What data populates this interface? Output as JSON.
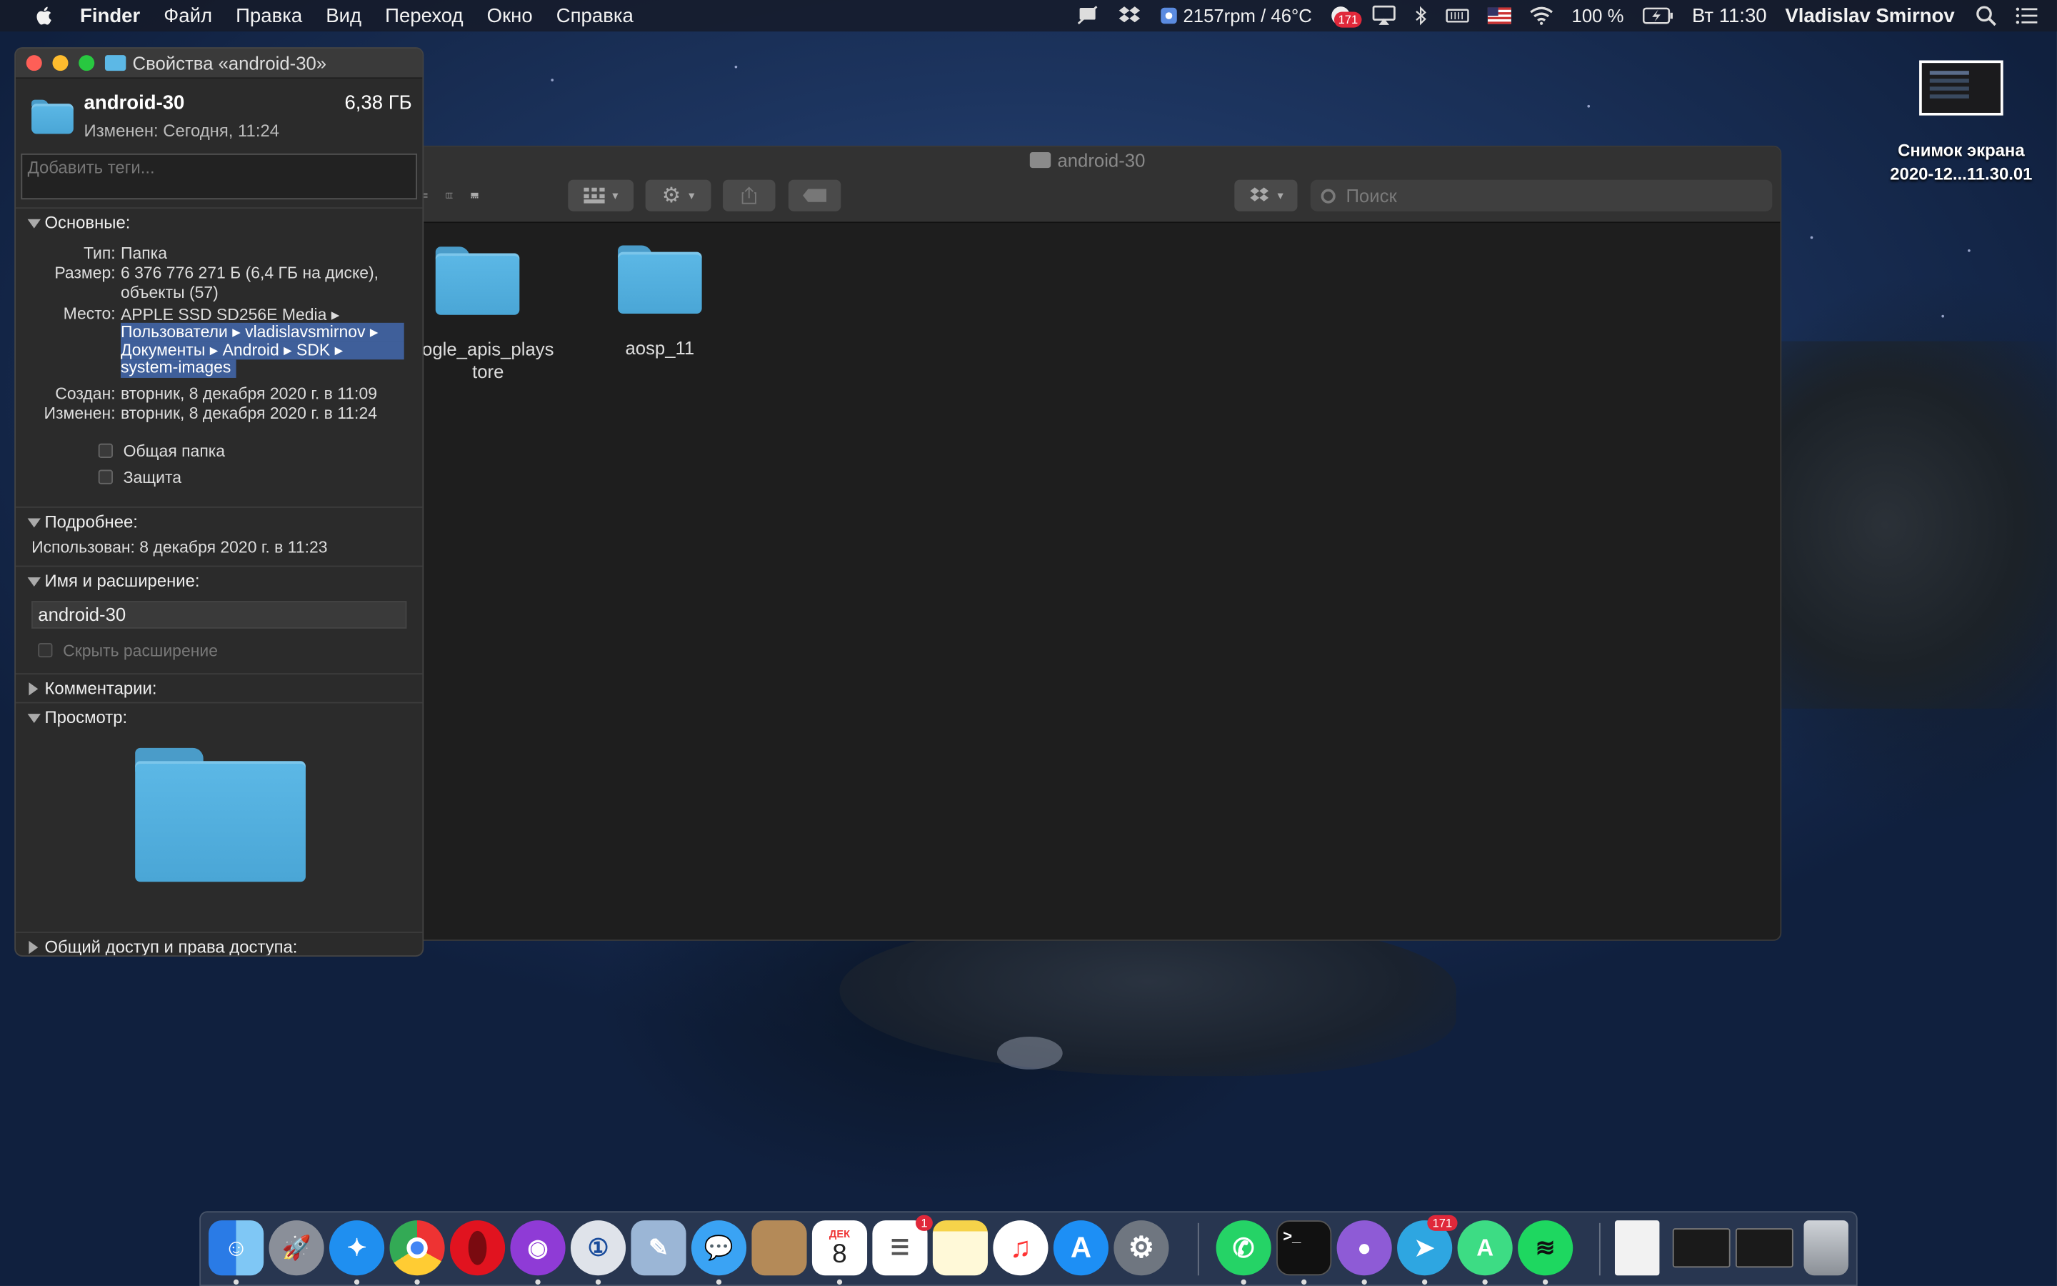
{
  "menubar": {
    "app": "Finder",
    "items": [
      "Файл",
      "Правка",
      "Вид",
      "Переход",
      "Окно",
      "Справка"
    ],
    "fan_status": "2157rpm / 46°C",
    "badge_count": "171",
    "battery": "100 %",
    "clock": "Вт 11:30",
    "user": "Vladislav Smirnov"
  },
  "desktop_file": {
    "line1": "Снимок экрана",
    "line2": "2020-12...11.30.01"
  },
  "finder": {
    "title": "android-30",
    "search_placeholder": "Поиск",
    "items": [
      "ogle_apis_playstore",
      "aosp_11"
    ]
  },
  "info": {
    "window_title": "Свойства «android-30»",
    "name": "android-30",
    "size": "6,38 ГБ",
    "modified": "Изменен: Сегодня, 11:24",
    "tags_placeholder": "Добавить теги...",
    "general": {
      "header": "Основные:",
      "type_k": "Тип:",
      "type_v": "Папка",
      "size_k": "Размер:",
      "size_v1": "6 376 776 271 Б (6,4 ГБ на диске),",
      "size_v2": "объекты (57)",
      "where_k": "Место:",
      "where_v1": "APPLE SSD SD256E Media ▸",
      "where_v2": "Пользователи ▸ vladislavsmirnov ▸",
      "where_v3": "Документы ▸ Android ▸ SDK ▸",
      "where_v4": "system-images",
      "created_k": "Создан:",
      "created_v": "вторник, 8 декабря 2020 г. в 11:09",
      "modified_k": "Изменен:",
      "modified_v": "вторник, 8 декабря 2020 г. в 11:24",
      "shared_folder": "Общая папка",
      "locked": "Защита"
    },
    "more": {
      "header": "Подробнее:",
      "used": "Использован: 8 декабря 2020 г. в 11:23"
    },
    "name_ext": {
      "header": "Имя и расширение:",
      "value": "android-30",
      "hide_ext": "Скрыть расширение"
    },
    "comments_header": "Комментарии:",
    "preview_header": "Просмотр:",
    "sharing_header": "Общий доступ и права доступа:"
  },
  "dock": {
    "calendar_month": "ДЕК",
    "calendar_day": "8",
    "reminders_badge": "1",
    "telegram_badge": "171",
    "apps": [
      "finder-icon",
      "launchpad-icon",
      "safari-icon",
      "chrome-icon",
      "opera-icon",
      "podcasts-icon",
      "1password-icon",
      "preview-icon",
      "messages-icon",
      "contacts-icon",
      "calendar-icon",
      "reminders-icon",
      "notes-icon",
      "music-icon",
      "appstore-icon",
      "system-preferences-icon",
      "whatsapp-icon",
      "terminal-icon",
      "github-icon",
      "telegram-icon",
      "android-studio-icon",
      "spotify-icon",
      "document-icon",
      "screenshot-icon",
      "window-icon",
      "trash-icon"
    ]
  },
  "colors": {
    "accent": "#5cb8e6",
    "selection": "#3f5f9a",
    "window_bg": "#1e1e1e",
    "panel_bg": "#2b2b2b"
  }
}
